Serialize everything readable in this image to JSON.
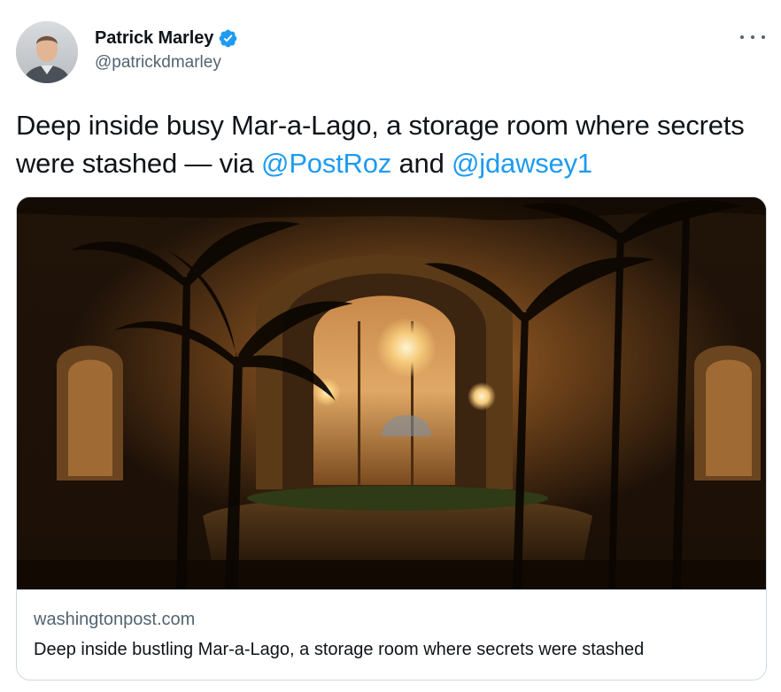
{
  "author": {
    "display_name": "Patrick Marley",
    "handle": "@patrickdmarley",
    "verified": true
  },
  "tweet": {
    "text_before": "Deep inside busy Mar-a-Lago, a storage room where secrets were stashed — via ",
    "mention_1": "@PostRoz",
    "text_between": " and ",
    "mention_2": "@jdawsey1"
  },
  "card": {
    "domain": "washingtonpost.com",
    "title": "Deep inside bustling Mar-a-Lago, a storage room where secrets were stashed"
  },
  "icons": {
    "verified": "verified-badge-icon",
    "more": "more-options-icon"
  },
  "colors": {
    "link": "#1d9bf0",
    "text": "#0f1419",
    "secondary": "#536471",
    "border": "#cfd9de"
  }
}
